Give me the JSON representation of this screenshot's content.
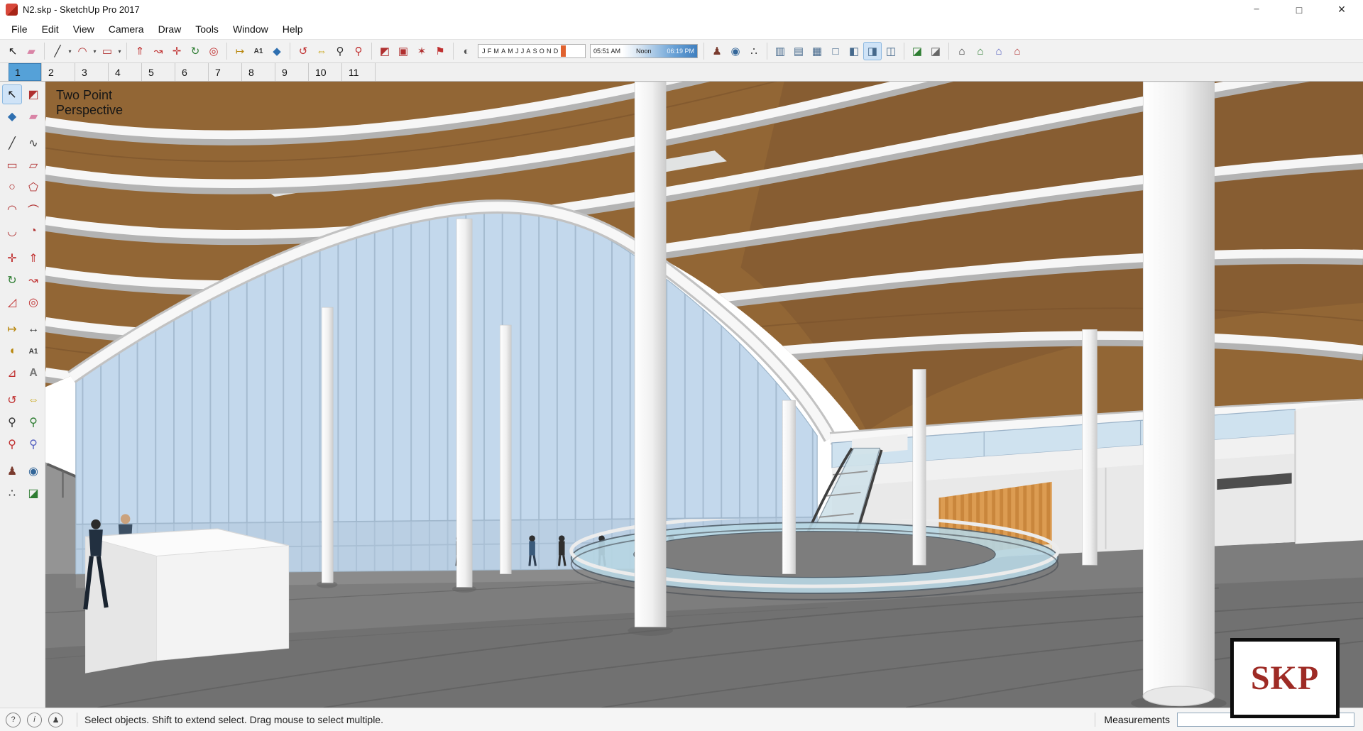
{
  "window": {
    "title": "N2.skp - SketchUp Pro 2017"
  },
  "menu_bar": {
    "items": [
      "File",
      "Edit",
      "View",
      "Camera",
      "Draw",
      "Tools",
      "Window",
      "Help"
    ]
  },
  "toolbar": {
    "icons": [
      "select",
      "eraser",
      "line",
      "arc",
      "shapes",
      "push-pull",
      "follow-me",
      "move",
      "rotate",
      "offset",
      "tape-measure",
      "text",
      "paint-bucket",
      "orbit",
      "pan",
      "zoom",
      "zoom-extents",
      "make-component",
      "make-group",
      "explode",
      "add-location",
      "shadows-toggle",
      "position-camera",
      "look-around",
      "walk",
      "x-ray",
      "back-edges",
      "wireframe",
      "hidden-line",
      "shaded",
      "shaded-with-textures",
      "monochrome",
      "section-plane",
      "section-cuts",
      "3d-warehouse",
      "share-model",
      "share-component",
      "extension-warehouse"
    ],
    "active_style": "shaded-with-textures",
    "shadow": {
      "months_text": "JFMAMJJASOND",
      "time_start": "05:51 AM",
      "time_mid": "Noon",
      "time_end": "06:19 PM"
    }
  },
  "scene_tabs": {
    "tabs": [
      "1",
      "2",
      "3",
      "4",
      "5",
      "6",
      "7",
      "8",
      "9",
      "10",
      "11"
    ],
    "selected": "1"
  },
  "tool_palette": {
    "icons": [
      "select",
      "make-component",
      "paint-bucket",
      "eraser",
      "line",
      "freehand",
      "rectangle",
      "rotated-rectangle",
      "circle",
      "polygon",
      "arc",
      "two-point-arc",
      "three-point-arc",
      "pie",
      "move",
      "push-pull",
      "rotate",
      "follow-me",
      "scale",
      "offset",
      "tape-measure",
      "dimension",
      "protractor",
      "text",
      "axes",
      "3d-text",
      "orbit",
      "pan",
      "zoom",
      "zoom-window",
      "zoom-extents",
      "zoom-previous",
      "position-camera",
      "look-around",
      "walk",
      "section-plane"
    ],
    "active_tool": "select"
  },
  "viewport": {
    "camera_label": [
      "Two Point",
      "Perspective"
    ],
    "watermark": "SKP"
  },
  "status_bar": {
    "message": "Select objects. Shift to extend select. Drag mouse to select multiple.",
    "measurements_label": "Measurements",
    "measurements_value": ""
  },
  "colors": {
    "selected_tab": "#55a1d8",
    "roof_brown": "#926635",
    "glass_blue": "#c7dbed",
    "floor_gray": "#7d7d7d",
    "logo_red": "#9e2b25",
    "app_icon_red": "#d8473a"
  }
}
